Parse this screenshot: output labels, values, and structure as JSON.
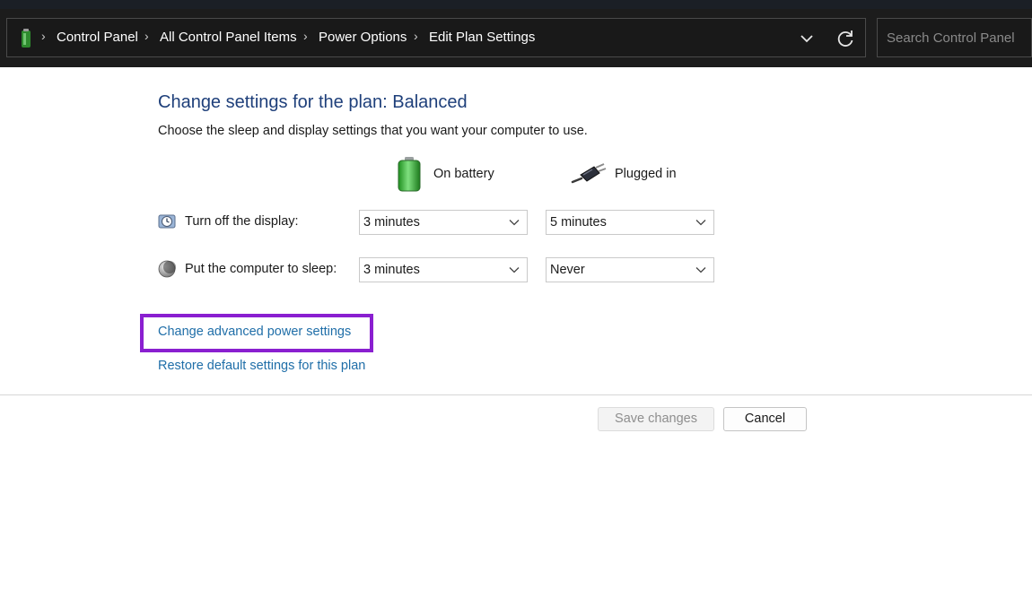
{
  "address_bar": {
    "breadcrumbs": [
      {
        "label": "Control Panel"
      },
      {
        "label": "All Control Panel Items"
      },
      {
        "label": "Power Options"
      },
      {
        "label": "Edit Plan Settings"
      }
    ],
    "location_icon": "power-options-icon",
    "dropdown_icon": "chevron-down-icon",
    "refresh_icon": "refresh-icon",
    "search_placeholder": "Search Control Panel"
  },
  "content": {
    "title": "Change settings for the plan: Balanced",
    "subtitle": "Choose the sleep and display settings that you want your computer to use.",
    "columns": {
      "battery": {
        "label": "On battery",
        "icon": "battery-icon"
      },
      "plugged": {
        "label": "Plugged in",
        "icon": "power-plug-icon"
      }
    },
    "rows": [
      {
        "label": "Turn off the display:",
        "icon": "display-icon",
        "battery_value": "3 minutes",
        "plugged_value": "5 minutes"
      },
      {
        "label": "Put the computer to sleep:",
        "icon": "sleep-moon-icon",
        "battery_value": "3 minutes",
        "plugged_value": "Never"
      }
    ],
    "links": {
      "advanced": "Change advanced power settings",
      "restore": "Restore default settings for this plan"
    },
    "highlight_color": "#8a1fd0"
  },
  "buttons": {
    "save": "Save changes",
    "cancel": "Cancel"
  },
  "colors": {
    "title": "#1e3f7a",
    "link": "#1f6ea8",
    "address_bar_bg": "#1c1c1c"
  }
}
